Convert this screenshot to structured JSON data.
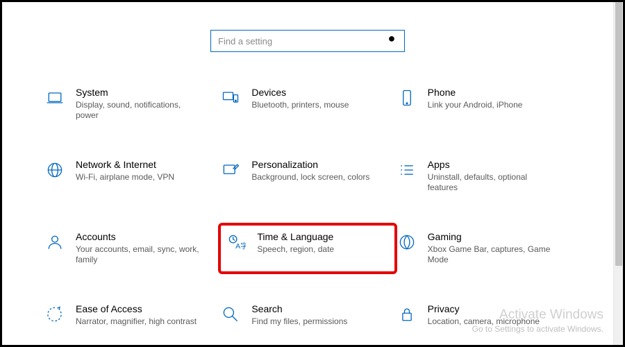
{
  "search": {
    "placeholder": "Find a setting"
  },
  "tiles": {
    "system": {
      "title": "System",
      "desc": "Display, sound, notifications, power"
    },
    "devices": {
      "title": "Devices",
      "desc": "Bluetooth, printers, mouse"
    },
    "phone": {
      "title": "Phone",
      "desc": "Link your Android, iPhone"
    },
    "network": {
      "title": "Network & Internet",
      "desc": "Wi-Fi, airplane mode, VPN"
    },
    "personalization": {
      "title": "Personalization",
      "desc": "Background, lock screen, colors"
    },
    "apps": {
      "title": "Apps",
      "desc": "Uninstall, defaults, optional features"
    },
    "accounts": {
      "title": "Accounts",
      "desc": "Your accounts, email, sync, work, family"
    },
    "time": {
      "title": "Time & Language",
      "desc": "Speech, region, date"
    },
    "gaming": {
      "title": "Gaming",
      "desc": "Xbox Game Bar, captures, Game Mode"
    },
    "ease": {
      "title": "Ease of Access",
      "desc": "Narrator, magnifier, high contrast"
    },
    "search": {
      "title": "Search",
      "desc": "Find my files, permissions"
    },
    "privacy": {
      "title": "Privacy",
      "desc": "Location, camera, microphone"
    }
  },
  "highlighted_tile": "time",
  "watermark": {
    "line1": "Activate Windows",
    "line2": "Go to Settings to activate Windows."
  }
}
